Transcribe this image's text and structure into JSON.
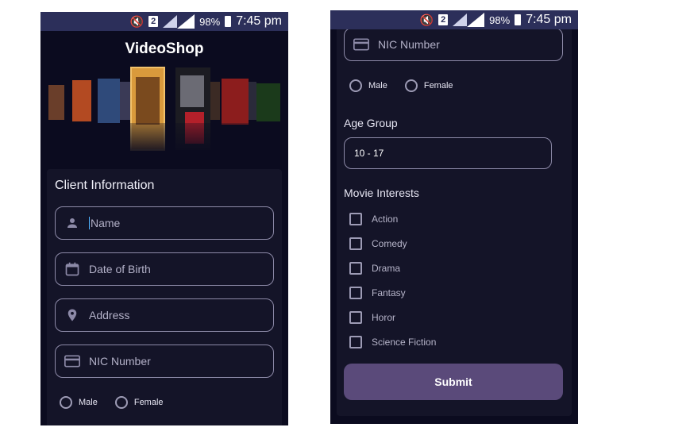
{
  "status_bar": {
    "sim_slot": "2",
    "battery": "98%",
    "time": "7:45 pm"
  },
  "app": {
    "title": "VideoShop"
  },
  "form": {
    "section_title": "Client Information",
    "fields": {
      "name": "Name",
      "dob": "Date of Birth",
      "address": "Address",
      "nic": "NIC Number"
    },
    "gender": {
      "male": "Male",
      "female": "Female"
    },
    "age_group": {
      "label": "Age Group",
      "value": "10 - 17"
    },
    "movie_interests": {
      "label": "Movie Interests",
      "options": [
        "Action",
        "Comedy",
        "Drama",
        "Fantasy",
        "Horor",
        "Science Fiction"
      ]
    },
    "submit_label": "Submit"
  },
  "colors": {
    "background": "#0b0b1f",
    "card": "#141428",
    "status_bar": "#2c2f5a",
    "button": "#5a4a7a",
    "border": "#8d8aa8"
  }
}
